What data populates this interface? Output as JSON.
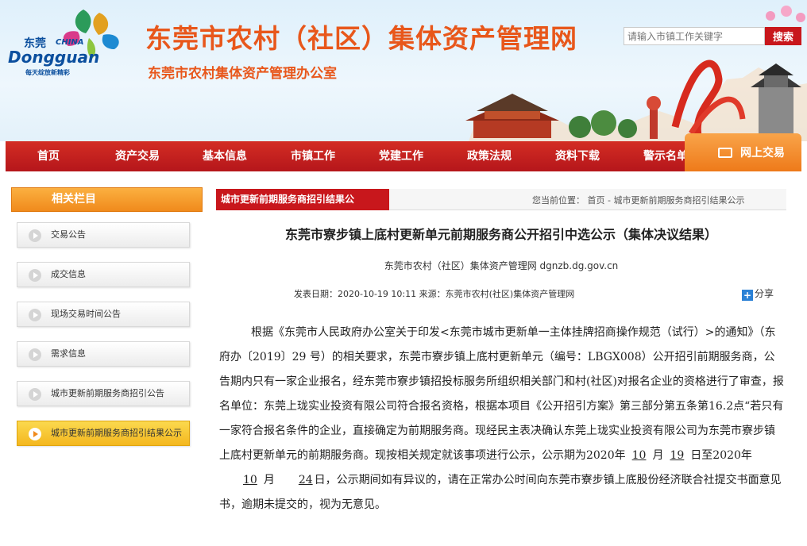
{
  "header": {
    "logo_cn": "东莞",
    "logo_china": "CHINA",
    "logo_en": "Dongguan",
    "logo_slogan": "每天绽放新精彩",
    "site_title": "东莞市农村（社区）集体资产管理网",
    "site_subtitle": "东莞市农村集体资产管理办公室",
    "search_placeholder": "请输入市镇工作关键字",
    "search_button": "搜索"
  },
  "nav": {
    "items": [
      "首页",
      "资产交易",
      "基本信息",
      "市镇工作",
      "党建工作",
      "政策法规",
      "资料下载",
      "警示名单"
    ],
    "online_trade": "网上交易"
  },
  "sidebar": {
    "heading": "相关栏目",
    "items": [
      {
        "label": "交易公告"
      },
      {
        "label": "成交信息"
      },
      {
        "label": "现场交易时间公告"
      },
      {
        "label": "需求信息"
      },
      {
        "label": "城市更新前期服务商招引公告"
      },
      {
        "label": "城市更新前期服务商招引结果公示"
      }
    ]
  },
  "breadcrumb": {
    "tab": "城市更新前期服务商招引结果公",
    "location": "您当前位置：   首页 - 城市更新前期服务商招引结果公示"
  },
  "article": {
    "title": "东莞市寮步镇上底村更新单元前期服务商公开招引中选公示（集体决议结果）",
    "source_line": "东莞市农村（社区）集体资产管理网    dgnzb.dg.gov.cn",
    "meta": "发表日期：2020-10-19 10:11      来源：东莞市农村(社区)集体资产管理网",
    "share": "分享",
    "body_part1": "根据《东莞市人民政府办公室关于印发<东莞市城市更新单一主体挂牌招商操作规范（试行）>的通知》（东府办〔2019〕29 号）的相关要求，东莞市寮步镇上底村更新单元（编号：LBGX008）公开招引前期服务商，公告期内只有一家企业报名，经东莞市寮步镇招投标服务所组织相关部门和村(社区)对报名企业的资格进行了审查，报名单位：东莞上珑实业投资有限公司符合报名资格，根据本项目《公开招引方案》第三部分第五条第16.2点“若只有一家符合报名条件的企业，直接确定为前期服务商。现经民主表决确认东莞上珑实业投资有限公司为东莞市寮步镇上底村更新单元的前期服务商。现按相关规定就该事项进行公示，公示期为2020年",
    "month1": "10",
    "t1": "月",
    "day1": "19",
    "t2": "日至2020年",
    "month2": "10",
    "t3": "月",
    "day2": "24",
    "body_part2": "日，公示期间如有异议的，请在正常办公时间向东莞市寮步镇上底股份经济联合社提交书面意见书，逾期未提交的，视为无意见。"
  }
}
